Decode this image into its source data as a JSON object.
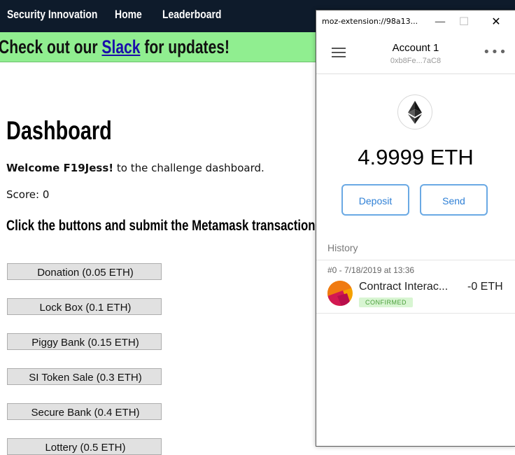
{
  "navbar": {
    "brand": "Security Innovation",
    "home": "Home",
    "leaderboard": "Leaderboard"
  },
  "banner": {
    "prefix": "Check out our ",
    "link": "Slack",
    "suffix": " for updates!"
  },
  "dashboard": {
    "title": "Dashboard",
    "welcome_user": "Welcome F19Jess!",
    "welcome_rest": " to the challenge dashboard.",
    "score": "Score: 0",
    "instruction": "Click the buttons and submit the Metamask transactions t"
  },
  "challenges": [
    "Donation (0.05 ETH)",
    "Lock Box (0.1 ETH)",
    "Piggy Bank (0.15 ETH)",
    "SI Token Sale (0.3 ETH)",
    "Secure Bank (0.4 ETH)",
    "Lottery (0.5 ETH)"
  ],
  "popup": {
    "window_title": "moz-extension://98a13...",
    "minimize": "—",
    "maximize": "☐",
    "close": "✕",
    "account_name": "Account 1",
    "account_address": "0xb8Fe...7aC8",
    "menu_glyph": "•••",
    "balance": "4.9999 ETH",
    "deposit_label": "Deposit",
    "send_label": "Send",
    "history_label": "History",
    "transaction": {
      "date": "#0 - 7/18/2019 at 13:36",
      "title": "Contract Interac...",
      "status": "CONFIRMED",
      "amount": "-0 ETH"
    }
  },
  "colors": {
    "navbar_bg": "#0e1b2b",
    "banner_bg": "#90ee90",
    "link": "#1a0dab",
    "metamask_blue": "#2f80d6",
    "confirmed_bg": "#d8f5d2",
    "confirmed_text": "#4a9e3a"
  },
  "icons": {
    "menu": "hamburger-icon",
    "options": "kebab-menu-icon",
    "currency": "ethereum-icon",
    "transaction": "contract-interaction-icon"
  }
}
